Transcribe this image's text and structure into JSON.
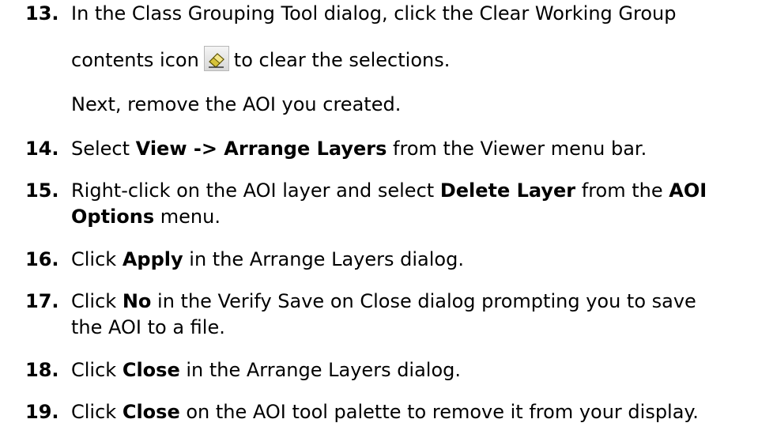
{
  "steps": [
    {
      "num": "13.",
      "lines": [
        {
          "segments": [
            {
              "t": "In the Class Grouping Tool dialog, click the Clear Working Group",
              "b": false
            }
          ]
        },
        {
          "segments": [
            {
              "t": "contents icon",
              "b": false
            },
            {
              "icon": "eraser-icon"
            },
            {
              "t": "to clear the selections.",
              "b": false
            }
          ]
        },
        {
          "segments": [
            {
              "t": "Next, remove the AOI you created.",
              "b": false
            }
          ]
        }
      ]
    },
    {
      "num": "14.",
      "lines": [
        {
          "segments": [
            {
              "t": "Select ",
              "b": false
            },
            {
              "t": "View -> Arrange Layers",
              "b": true
            },
            {
              "t": " from the Viewer menu bar.",
              "b": false
            }
          ]
        }
      ]
    },
    {
      "num": "15.",
      "lines": [
        {
          "segments": [
            {
              "t": "Right-click on the AOI layer and select ",
              "b": false
            },
            {
              "t": "Delete Layer",
              "b": true
            },
            {
              "t": " from the ",
              "b": false
            },
            {
              "t": "AOI",
              "b": true
            }
          ]
        },
        {
          "segments": [
            {
              "t": "Options",
              "b": true
            },
            {
              "t": " menu.",
              "b": false
            }
          ]
        }
      ]
    },
    {
      "num": "16.",
      "lines": [
        {
          "segments": [
            {
              "t": "Click ",
              "b": false
            },
            {
              "t": "Apply",
              "b": true
            },
            {
              "t": " in the Arrange Layers dialog.",
              "b": false
            }
          ]
        }
      ]
    },
    {
      "num": "17.",
      "lines": [
        {
          "segments": [
            {
              "t": "Click ",
              "b": false
            },
            {
              "t": "No",
              "b": true
            },
            {
              "t": " in the Verify Save on Close dialog prompting you to save",
              "b": false
            }
          ]
        },
        {
          "segments": [
            {
              "t": "the AOI to a file.",
              "b": false
            }
          ]
        }
      ]
    },
    {
      "num": "18.",
      "lines": [
        {
          "segments": [
            {
              "t": "Click ",
              "b": false
            },
            {
              "t": "Close",
              "b": true
            },
            {
              "t": " in the Arrange Layers dialog.",
              "b": false
            }
          ]
        }
      ]
    },
    {
      "num": "19.",
      "lines": [
        {
          "segments": [
            {
              "t": "Click ",
              "b": false
            },
            {
              "t": "Close",
              "b": true
            },
            {
              "t": " on the AOI tool palette to remove it from your display.",
              "b": false
            }
          ]
        }
      ]
    }
  ]
}
